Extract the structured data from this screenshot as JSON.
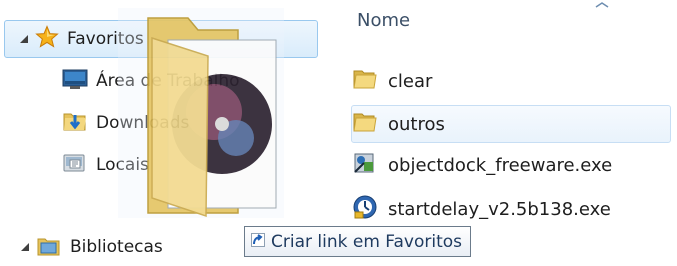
{
  "nav_tree": {
    "favorites": {
      "label": "Favoritos",
      "expanded": true,
      "icon": "star-icon"
    },
    "items": [
      {
        "label": "Área de Trabalho",
        "icon": "desktop-icon"
      },
      {
        "label": "Downloads",
        "icon": "downloads-folder-icon"
      },
      {
        "label": "Locais",
        "icon": "recent-places-icon"
      }
    ],
    "libraries": {
      "label": "Bibliotecas",
      "expanded": true,
      "icon": "libraries-icon"
    }
  },
  "file_list": {
    "column_header": "Nome",
    "files": [
      {
        "name": "clear",
        "type": "folder",
        "icon": "folder-icon"
      },
      {
        "name": "outros",
        "type": "folder",
        "icon": "folder-icon",
        "hovered": true
      },
      {
        "name": "objectdock_freeware.exe",
        "type": "exe",
        "icon": "installer-icon"
      },
      {
        "name": "startdelay_v2.5b138.exe",
        "type": "exe",
        "icon": "installer-icon"
      }
    ]
  },
  "drag_tooltip": {
    "text": "Criar link em Favoritos",
    "icon": "shortcut-arrow-icon"
  },
  "colors": {
    "selection_border": "#99c8ee",
    "selection_fill": "#d9ecfb",
    "folder_yellow": "#f0d67c",
    "text_primary": "#1e1e1e"
  }
}
